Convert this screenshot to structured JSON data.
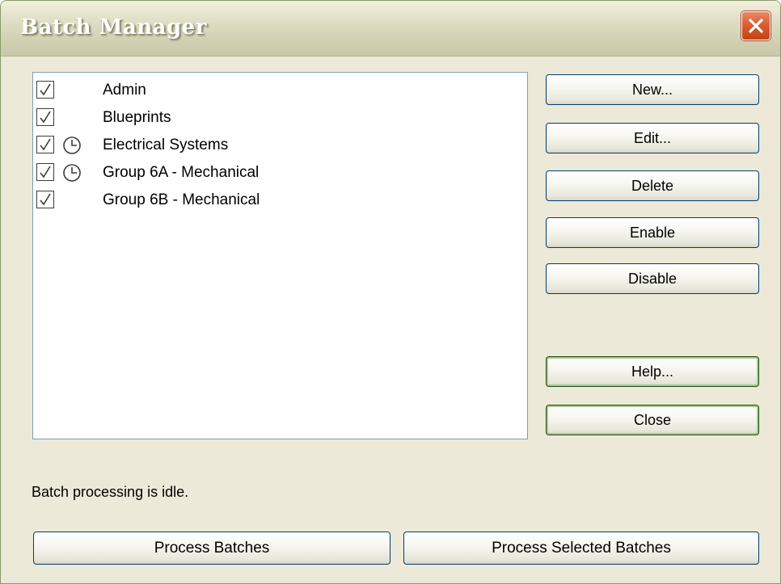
{
  "window": {
    "title": "Batch Manager",
    "close_icon": "close-icon"
  },
  "batches": [
    {
      "label": "Admin",
      "checked": true,
      "scheduled": false
    },
    {
      "label": "Blueprints",
      "checked": true,
      "scheduled": false
    },
    {
      "label": "Electrical Systems",
      "checked": true,
      "scheduled": true
    },
    {
      "label": "Group 6A - Mechanical",
      "checked": true,
      "scheduled": true
    },
    {
      "label": "Group 6B - Mechanical",
      "checked": true,
      "scheduled": false
    }
  ],
  "buttons": {
    "new": "New...",
    "edit": "Edit...",
    "delete": "Delete",
    "enable": "Enable",
    "disable": "Disable",
    "help": "Help...",
    "close": "Close"
  },
  "status_text": "Batch processing is idle.",
  "bottom_buttons": {
    "process": "Process Batches",
    "process_selected": "Process Selected Batches"
  },
  "colors": {
    "dialog_background": "#ece9d8",
    "close_button": "#d85a2e",
    "button_border": "#003c74"
  }
}
